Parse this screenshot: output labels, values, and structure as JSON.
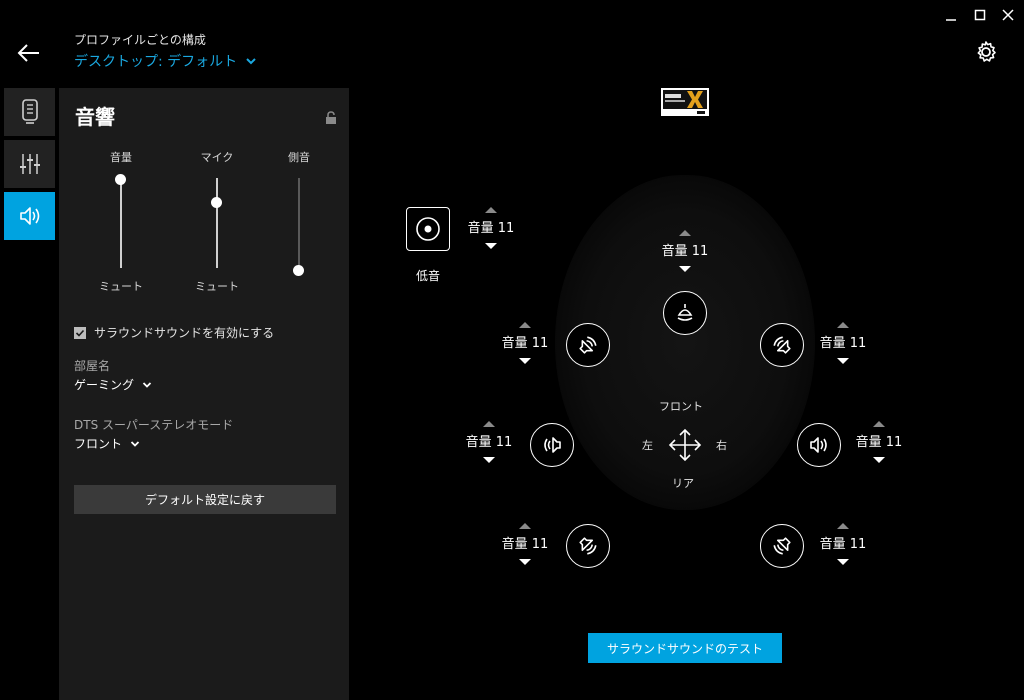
{
  "window": {
    "controls": [
      "minimize-icon",
      "maximize-icon",
      "close-icon"
    ]
  },
  "header": {
    "subtitle": "プロファイルごとの構成",
    "profile": "デスクトップ: デフォルト",
    "accent": "#1aa8e0"
  },
  "tabs": [
    {
      "icon": "headset-device-icon",
      "active": false
    },
    {
      "icon": "equalizer-icon",
      "active": false
    },
    {
      "icon": "speaker-icon",
      "active": true
    }
  ],
  "panel": {
    "title": "音響",
    "sliders": [
      {
        "label": "音量",
        "bottom": "ミュート",
        "level": 1.0
      },
      {
        "label": "マイク",
        "bottom": "ミュート",
        "level": 0.78
      },
      {
        "label": "側音",
        "bottom": "",
        "level": 0.0
      }
    ],
    "surround_checkbox": {
      "label": "サラウンドサウンドを有効にする",
      "checked": true
    },
    "room": {
      "label": "部屋名",
      "value": "ゲーミング"
    },
    "dts_mode": {
      "label": "DTS スーパーステレオモード",
      "value": "フロント"
    },
    "reset_button": "デフォルト設定に戻す"
  },
  "surround": {
    "subwoofer_label": "低音",
    "volume_label": "音量 11",
    "front": "フロント",
    "rear": "リア",
    "left": "左",
    "right": "右",
    "test_button": "サラウンドサウンドのテスト"
  }
}
